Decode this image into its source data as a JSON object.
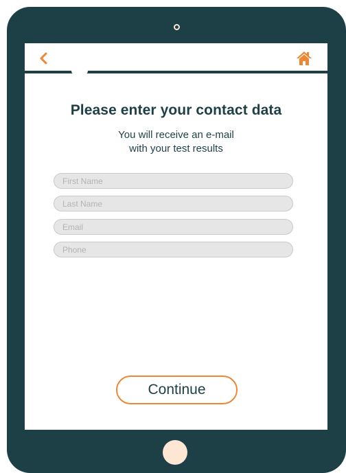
{
  "colors": {
    "frame": "#1d3f46",
    "accent": "#ef8633",
    "field_bg": "#e6e6e6",
    "home_button": "#fde6d4"
  },
  "header": {
    "back_icon": "chevron-left-icon",
    "home_icon": "home-icon"
  },
  "main": {
    "title": "Please enter your contact data",
    "subtitle_line1": "You will receive an e-mail",
    "subtitle_line2": "with your test results"
  },
  "form": {
    "first_name": {
      "placeholder": "First Name",
      "value": ""
    },
    "last_name": {
      "placeholder": "Last Name",
      "value": ""
    },
    "email": {
      "placeholder": "Email",
      "value": ""
    },
    "phone": {
      "placeholder": "Phone",
      "value": ""
    }
  },
  "actions": {
    "continue_label": "Continue"
  }
}
